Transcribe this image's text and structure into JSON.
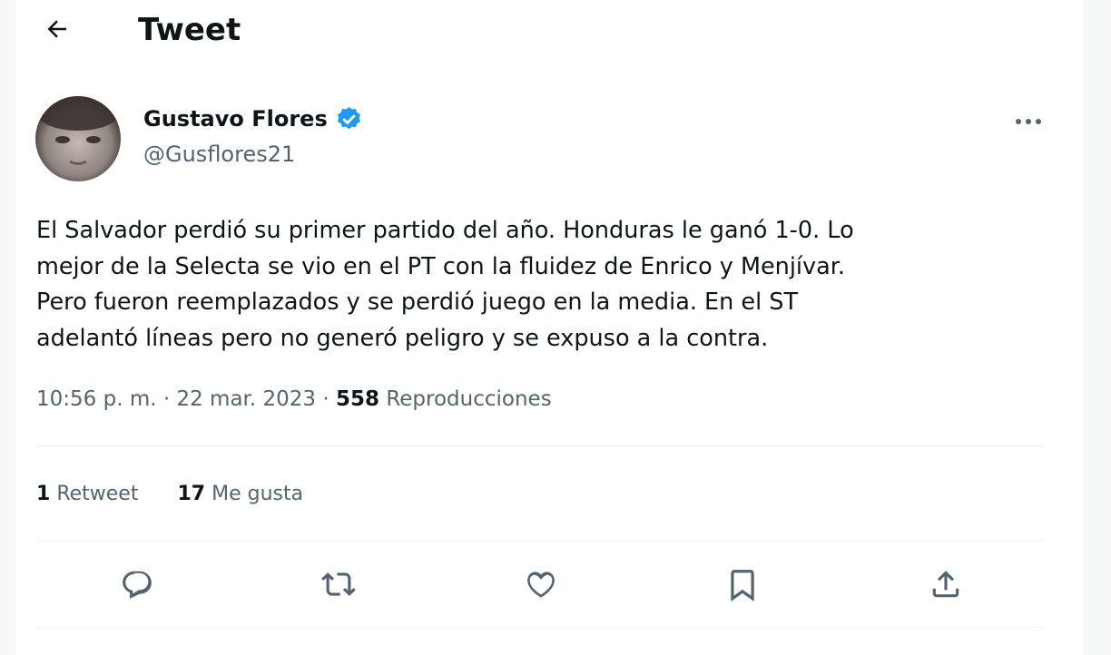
{
  "header": {
    "title": "Tweet",
    "back_icon": "arrow-left-icon"
  },
  "author": {
    "name": "Gustavo Flores",
    "handle": "@Gusflores21",
    "verified_icon": "verified-badge-icon",
    "verified_color": "#1d9bf0"
  },
  "tweet": {
    "lines": [
      "El Salvador perdió su primer partido del año. Honduras le ganó 1-0. Lo",
      "mejor de la Selecta se vio en el PT con la fluidez de Enrico y Menjívar.",
      "Pero fueron reemplazados y se perdió juego en la media. En el ST",
      "adelantó líneas pero no generó peligro y se expuso a la contra."
    ],
    "time": "10:56 p. m.",
    "separator": "·",
    "date": "22 mar. 2023",
    "views_count": "558",
    "views_label": "Reproducciones"
  },
  "stats": {
    "retweets_count": "1",
    "retweets_label": "Retweet",
    "likes_count": "17",
    "likes_label": "Me gusta"
  },
  "actions": [
    "reply-icon",
    "retweet-icon",
    "like-icon",
    "bookmark-icon",
    "share-icon"
  ],
  "colors": {
    "text": "#0f1419",
    "secondary": "#536471",
    "divider": "#eff3f4",
    "icon": "#536471"
  }
}
